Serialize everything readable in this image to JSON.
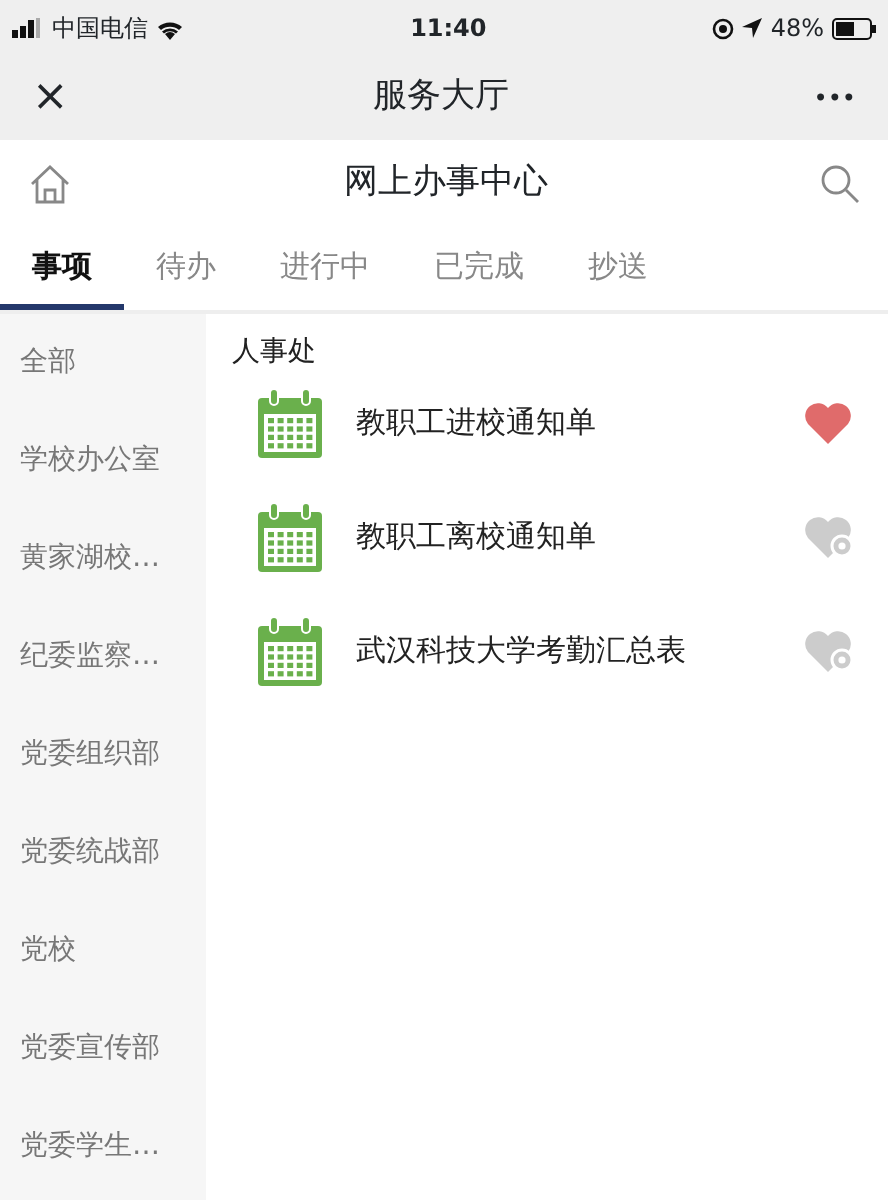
{
  "status_bar": {
    "carrier": "中国电信",
    "time": "11:40",
    "battery": "48%"
  },
  "nav_bar": {
    "title": "服务大厅",
    "close": "×",
    "more": "•••"
  },
  "header": {
    "title": "网上办事中心"
  },
  "tabs": [
    {
      "label": "事项",
      "selected": true
    },
    {
      "label": "待办",
      "selected": false
    },
    {
      "label": "进行中",
      "selected": false
    },
    {
      "label": "已完成",
      "selected": false
    },
    {
      "label": "抄送",
      "selected": false
    }
  ],
  "sidebar": {
    "items": [
      "全部",
      "学校办公室",
      "黄家湖校…",
      "纪委监察…",
      "党委组织部",
      "党委统战部",
      "党校",
      "党委宣传部",
      "党委学生…"
    ]
  },
  "section": {
    "title": "人事处",
    "items": [
      {
        "label": "教职工进校通知单",
        "favorite": true
      },
      {
        "label": "教职工离校通知单",
        "favorite": false
      },
      {
        "label": "武汉科技大学考勤汇总表",
        "favorite": false
      }
    ]
  }
}
